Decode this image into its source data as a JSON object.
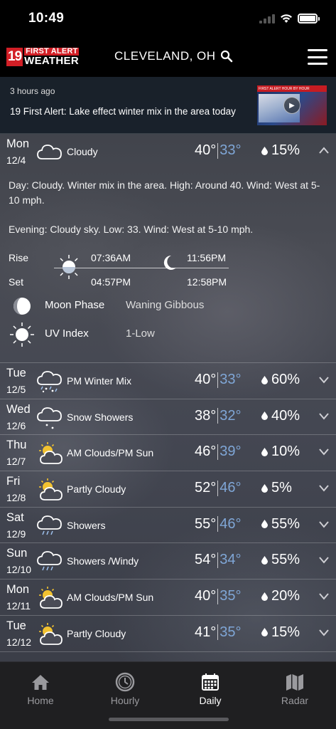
{
  "status_bar": {
    "time": "10:49"
  },
  "header": {
    "logo_number": "19",
    "logo_top": "FIRST ALERT",
    "logo_bottom": "WEATHER",
    "city": "CLEVELAND, OH"
  },
  "news": {
    "age": "3 hours ago",
    "headline": "19 First Alert:  Lake effect winter mix in the area today",
    "thumb_bar": "FIRST ALERT HOUR BY HOUR"
  },
  "today": {
    "day": "Mon",
    "date": "12/4",
    "condition": "Cloudy",
    "high": "40°",
    "low": "33°",
    "precip": "15%",
    "icon": "cloud-icon",
    "day_label": "Day:",
    "day_text": " Cloudy.  Winter mix in the area.  High: Around 40.  Wind: West at 5-10 mph.",
    "evening_label": "Evening:",
    "evening_text": " Cloudy sky.  Low: 33.  Wind: West at 5-10 mph.",
    "rise_label": "Rise",
    "set_label": "Set",
    "sunrise": "07:36AM",
    "sunset": "04:57PM",
    "moonrise": "11:56PM",
    "moonset": "12:58PM",
    "moon_phase_label": "Moon Phase",
    "moon_phase": "Waning Gibbous",
    "uv_label": "UV Index",
    "uv_value": "1-Low"
  },
  "forecast": [
    {
      "day": "Tue",
      "date": "12/5",
      "condition": "PM Winter Mix",
      "high": "40°",
      "low": "33°",
      "precip": "60%",
      "icon": "cloud-mix-icon"
    },
    {
      "day": "Wed",
      "date": "12/6",
      "condition": "Snow Showers",
      "high": "38°",
      "low": "32°",
      "precip": "40%",
      "icon": "cloud-snow-icon"
    },
    {
      "day": "Thu",
      "date": "12/7",
      "condition": "AM Clouds/PM Sun",
      "high": "46°",
      "low": "39°",
      "precip": "10%",
      "icon": "partly-cloudy-icon"
    },
    {
      "day": "Fri",
      "date": "12/8",
      "condition": "Partly Cloudy",
      "high": "52°",
      "low": "46°",
      "precip": "5%",
      "icon": "partly-cloudy-icon"
    },
    {
      "day": "Sat",
      "date": "12/9",
      "condition": "Showers",
      "high": "55°",
      "low": "46°",
      "precip": "55%",
      "icon": "cloud-rain-icon"
    },
    {
      "day": "Sun",
      "date": "12/10",
      "condition": "Showers /Windy",
      "high": "54°",
      "low": "34°",
      "precip": "55%",
      "icon": "cloud-rain-icon"
    },
    {
      "day": "Mon",
      "date": "12/11",
      "condition": "AM Clouds/PM Sun",
      "high": "40°",
      "low": "35°",
      "precip": "20%",
      "icon": "partly-cloudy-icon"
    },
    {
      "day": "Tue",
      "date": "12/12",
      "condition": "Partly Cloudy",
      "high": "41°",
      "low": "35°",
      "precip": "15%",
      "icon": "partly-cloudy-icon"
    }
  ],
  "nav": [
    {
      "label": "Home",
      "icon": "home-icon",
      "active": false
    },
    {
      "label": "Hourly",
      "icon": "clock-icon",
      "active": false
    },
    {
      "label": "Daily",
      "icon": "calendar-icon",
      "active": true
    },
    {
      "label": "Radar",
      "icon": "map-icon",
      "active": false
    }
  ],
  "colors": {
    "low_temp": "#7fa6d6",
    "brand_red": "#d21f26",
    "nav_bg": "#1f1f21"
  }
}
